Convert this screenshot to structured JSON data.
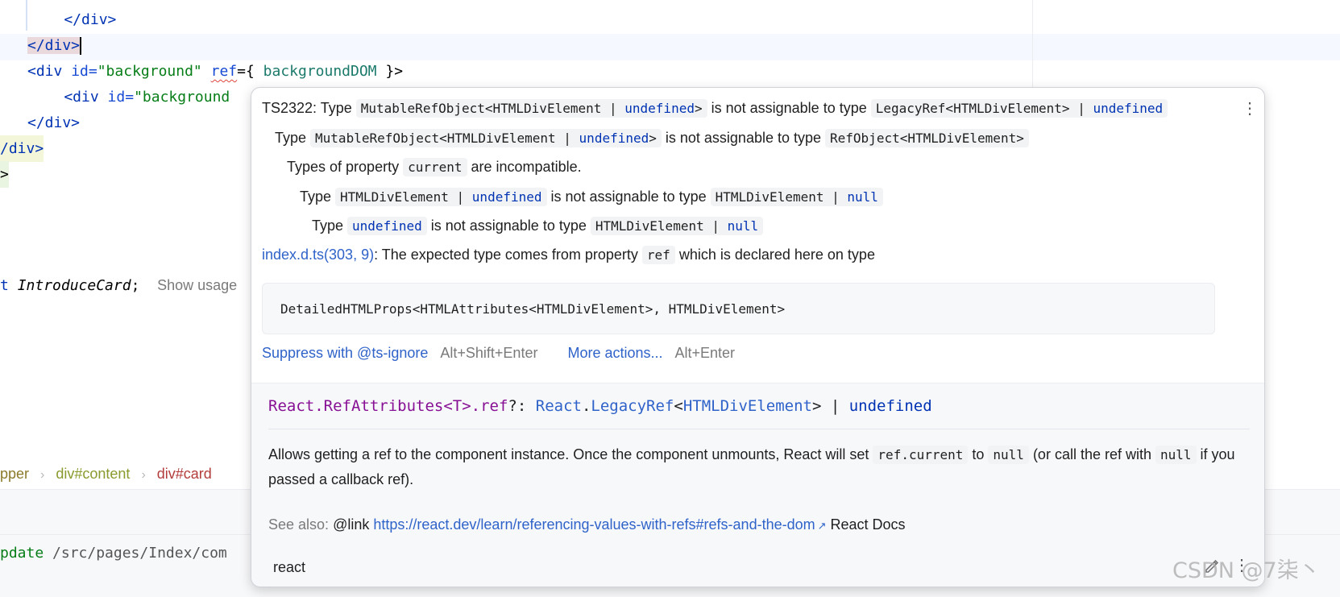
{
  "editor": {
    "l1": "    </div>",
    "l2_close": "</div>",
    "l3": {
      "open": "<div",
      "attr_id": " id=",
      "val": "\"background\"",
      "ref": "ref",
      "eq": "={ ",
      "ident": "backgroundDOM",
      "end": " }>"
    },
    "l4": {
      "open": "    <div",
      "attr_id": " id=",
      "val": "\"background"
    },
    "l5": "</div>",
    "l6": "/div>",
    "l7": ">",
    "l8": {
      "kw": "t ",
      "name": "IntroduceCard",
      "semi": ";",
      "inlay": "Show usage"
    }
  },
  "breadcrumb": {
    "item1": "pper",
    "item2": "div#content",
    "item3": "div#card"
  },
  "terminal": {
    "cmd": "pdate",
    "path": " /src/pages/Index/com"
  },
  "popup": {
    "l1": {
      "code_a": "TS2322",
      "t1": ": Type ",
      "c1": "MutableRefObject<HTMLDivElement | ",
      "c1_kw": "undefined",
      "c1_end": ">",
      "t2": " is not assignable to type ",
      "c2": "LegacyRef<HTMLDivElement> | ",
      "c2_kw": "undefined"
    },
    "l2": {
      "t1": "Type ",
      "c1": "MutableRefObject<HTMLDivElement | ",
      "c1_kw": "undefined",
      "c1_end": ">",
      "t2": " is not assignable to type ",
      "c2": "RefObject<HTMLDivElement>"
    },
    "l3": {
      "t1": "Types of property ",
      "c1": "current",
      "t2": " are incompatible."
    },
    "l4": {
      "t1": "Type ",
      "c1": "HTMLDivElement | ",
      "c1_kw": "undefined",
      "t2": " is not assignable to type ",
      "c2": "HTMLDivElement | ",
      "c2_kw": "null"
    },
    "l5": {
      "t1": "Type ",
      "c1_kw": "undefined",
      "t2": " is not assignable to type ",
      "c2": "HTMLDivElement | ",
      "c2_kw": "null"
    },
    "l6": {
      "link": "index.d.ts(303, 9)",
      "t1": ": The expected type comes from property ",
      "c1": "ref",
      "t2": " which is declared here on type"
    },
    "code_block": "DetailedHTMLProps<HTMLAttributes<HTMLDivElement>, HTMLDivElement>",
    "actions": {
      "suppress": "Suppress with @ts-ignore",
      "suppress_key": "Alt+Shift+Enter",
      "more": "More actions...",
      "more_key": "Alt+Enter"
    },
    "sig": {
      "a": "React.RefAttributes<T>.ref",
      "b": "?: ",
      "c": "React",
      "d": ".",
      "e": "LegacyRef",
      "f": "<",
      "g": "HTMLDivElement",
      "h": "> | ",
      "i": "undefined"
    },
    "desc": {
      "t1": "Allows getting a ref to the component instance. Once the component unmounts, React will set ",
      "c1": "ref.current",
      "t2": " to ",
      "c2": "null",
      "t3": " (or call the ref with ",
      "c3": "null",
      "t4": " if you passed a callback ref)."
    },
    "seealso": {
      "label": "See also:",
      "at": " @link ",
      "url": "https://react.dev/learn/referencing-values-with-refs#refs-and-the-dom",
      "ext": "↗",
      "docs": " React Docs"
    },
    "pkg": "react",
    "kebab": "⋮"
  },
  "watermark": "CSDN @7柒丶",
  "icons": [
    "kebab-menu-icon",
    "external-link-icon",
    "edit-pencil-icon",
    "chevron-right-icon"
  ]
}
